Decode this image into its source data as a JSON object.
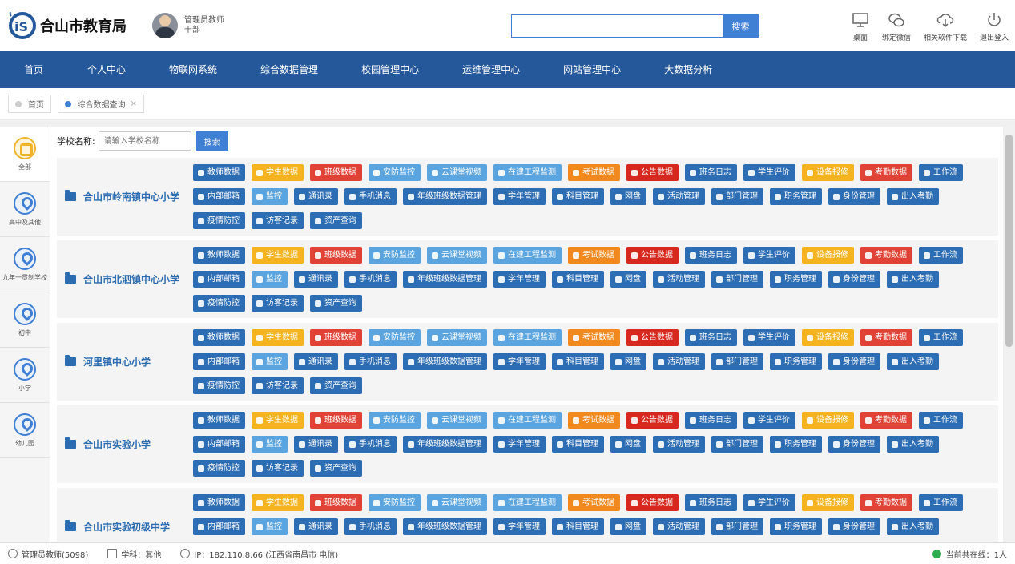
{
  "header": {
    "app_title": "合山市教育局",
    "user_name": "管理员教师",
    "user_role": "干部"
  },
  "search": {
    "placeholder": "",
    "button": "搜索"
  },
  "tools": [
    {
      "label": "桌面",
      "icon": "desktop-icon"
    },
    {
      "label": "绑定微信",
      "icon": "wechat-icon"
    },
    {
      "label": "相关软件下载",
      "icon": "cloud-download-icon"
    },
    {
      "label": "退出登入",
      "icon": "power-icon"
    }
  ],
  "nav": [
    "首页",
    "个人中心",
    "物联网系统",
    "综合数据管理",
    "校园管理中心",
    "运维管理中心",
    "网站管理中心",
    "大数据分析"
  ],
  "tabs": [
    {
      "label": "首页",
      "active": false
    },
    {
      "label": "综合数据查询",
      "active": true,
      "close": "×"
    }
  ],
  "sidebar": [
    "全部",
    "高中及其他",
    "九年一贯制学校",
    "初中",
    "小学",
    "幼儿园"
  ],
  "filter": {
    "label": "学校名称:",
    "placeholder": "请输入学校名称",
    "button": "搜索"
  },
  "buttons": [
    {
      "label": "教师数据",
      "color": "#2d6db4",
      "icon": "people-icon"
    },
    {
      "label": "学生数据",
      "color": "#f5b320",
      "icon": "student-icon"
    },
    {
      "label": "班级数据",
      "color": "#e04235",
      "icon": "class-icon"
    },
    {
      "label": "安防监控",
      "color": "#5aa4e0",
      "icon": "security-icon"
    },
    {
      "label": "云课堂视频",
      "color": "#5aa4e0",
      "icon": "cloud-class-icon"
    },
    {
      "label": "在建工程监测",
      "color": "#5aa4e0",
      "icon": "construction-icon"
    },
    {
      "label": "考试数据",
      "color": "#f2891e",
      "icon": "exam-icon"
    },
    {
      "label": "公告数据",
      "color": "#d6281e",
      "icon": "notice-icon"
    },
    {
      "label": "班务日志",
      "color": "#2d6db4",
      "icon": "log-icon"
    },
    {
      "label": "学生评价",
      "color": "#2d6db4",
      "icon": "evaluate-icon"
    },
    {
      "label": "设备报修",
      "color": "#f5b320",
      "icon": "repair-icon"
    },
    {
      "label": "考勤数据",
      "color": "#e04235",
      "icon": "attendance-icon"
    },
    {
      "label": "工作流",
      "color": "#2d6db4",
      "icon": "workflow-icon"
    },
    {
      "label": "内部邮箱",
      "color": "#2d6db4",
      "icon": "mail-icon"
    },
    {
      "label": "监控",
      "color": "#5aa4e0",
      "icon": "monitor-icon"
    },
    {
      "label": "通讯录",
      "color": "#2d6db4",
      "icon": "contacts-icon"
    },
    {
      "label": "手机消息",
      "color": "#2d6db4",
      "icon": "phone-message-icon"
    },
    {
      "label": "年级班级数据管理",
      "color": "#2d6db4",
      "icon": "grade-icon"
    },
    {
      "label": "学年管理",
      "color": "#2d6db4",
      "icon": "year-icon"
    },
    {
      "label": "科目管理",
      "color": "#2d6db4",
      "icon": "subject-icon"
    },
    {
      "label": "网盘",
      "color": "#2d6db4",
      "icon": "disk-icon"
    },
    {
      "label": "活动管理",
      "color": "#2d6db4",
      "icon": "activity-icon"
    },
    {
      "label": "部门管理",
      "color": "#2d6db4",
      "icon": "department-icon"
    },
    {
      "label": "职务管理",
      "color": "#2d6db4",
      "icon": "position-icon"
    },
    {
      "label": "身份管理",
      "color": "#2d6db4",
      "icon": "identity-icon"
    },
    {
      "label": "出入考勤",
      "color": "#2d6db4",
      "icon": "access-icon"
    },
    {
      "label": "疫情防控",
      "color": "#2d6db4",
      "icon": "epidemic-icon"
    },
    {
      "label": "访客记录",
      "color": "#2d6db4",
      "icon": "visitor-icon"
    },
    {
      "label": "资产查询",
      "color": "#2d6db4",
      "icon": "asset-icon"
    }
  ],
  "schools": [
    "合山市岭南镇中心小学",
    "合山市北泗镇中心小学",
    "河里镇中心小学",
    "合山市实验小学",
    "合山市实验初级中学"
  ],
  "status": {
    "user": "管理员教师(5098)",
    "subject": "学科：其他",
    "ip": "IP：182.110.8.66 (江西省南昌市 电信)",
    "online": "当前共在线：1人"
  }
}
